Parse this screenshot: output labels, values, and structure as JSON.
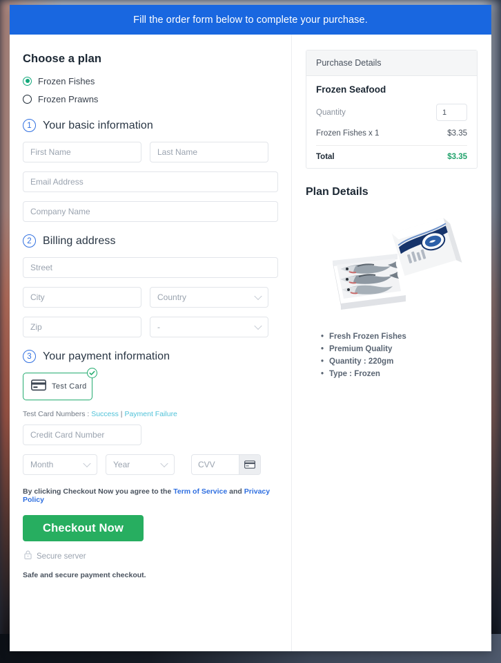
{
  "banner": {
    "text": "Fill the order form below to complete your purchase."
  },
  "plans": {
    "heading": "Choose a plan",
    "options": [
      {
        "label": "Frozen Fishes",
        "selected": true
      },
      {
        "label": "Frozen Prawns",
        "selected": false
      }
    ],
    "selected_color": "#12a87a"
  },
  "steps": {
    "basic": {
      "number": "1",
      "title": "Your basic information"
    },
    "billing": {
      "number": "2",
      "title": "Billing address"
    },
    "payment": {
      "number": "3",
      "title": "Your payment information"
    }
  },
  "fields": {
    "first_name": {
      "placeholder": "First Name",
      "value": ""
    },
    "last_name": {
      "placeholder": "Last Name",
      "value": ""
    },
    "email": {
      "placeholder": "Email Address",
      "value": ""
    },
    "company": {
      "placeholder": "Company Name",
      "value": ""
    },
    "street": {
      "placeholder": "Street",
      "value": ""
    },
    "city": {
      "placeholder": "City",
      "value": ""
    },
    "country": {
      "placeholder": "Country",
      "value": "Country"
    },
    "zip": {
      "placeholder": "Zip",
      "value": ""
    },
    "region": {
      "placeholder": "-",
      "value": "-"
    },
    "card_number": {
      "placeholder": "Credit Card Number",
      "value": ""
    },
    "month": {
      "placeholder": "Month",
      "value": "Month"
    },
    "year": {
      "placeholder": "Year",
      "value": "Year"
    },
    "cvv": {
      "placeholder": "CVV",
      "value": ""
    }
  },
  "payment": {
    "method_label": "Test  Card",
    "method_selected": true,
    "test_numbers_prefix": "Test Card Numbers : ",
    "link_success": "Success",
    "link_separator": " | ",
    "link_failure": "Payment Failure",
    "link_color": "#4fc2d8"
  },
  "terms": {
    "prefix": "By clicking Checkout Now you agree to the ",
    "tos": "Term of Service",
    "middle": " and ",
    "privacy": "Privacy Policy"
  },
  "actions": {
    "checkout_label": "Checkout Now",
    "checkout_color": "#27ae60",
    "secure_server": "Secure server",
    "safe_note": "Safe and secure payment checkout."
  },
  "purchase": {
    "header": "Purchase Details",
    "product": "Frozen Seafood",
    "quantity_label": "Quantity",
    "quantity_value": "1",
    "line_item_label": "Frozen Fishes x 1",
    "line_item_price": "$3.35",
    "total_label": "Total",
    "total_price": "$3.35",
    "total_color": "#20a26b"
  },
  "plan_details": {
    "title": "Plan Details",
    "image_alt": "frozen-fish-box-photo",
    "bullets": [
      "Fresh Frozen Fishes",
      "Premium Quality",
      "Quantity : 220gm",
      "Type : Frozen"
    ]
  }
}
